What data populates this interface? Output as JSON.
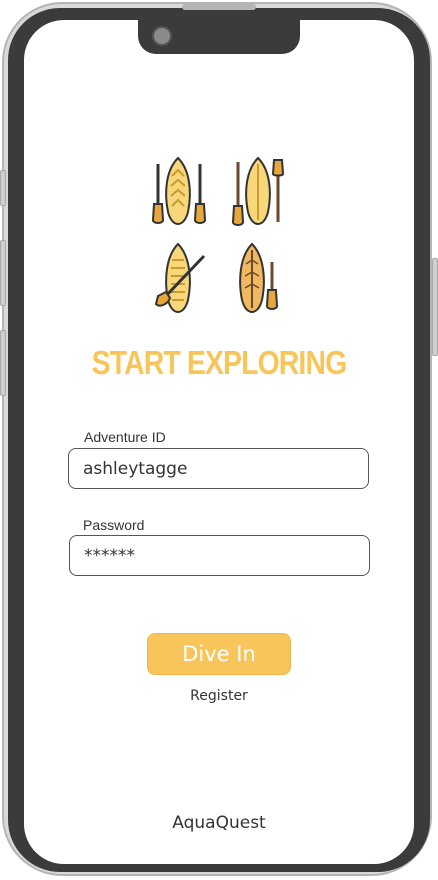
{
  "app": {
    "title": "START EXPLORING",
    "brand": "AquaQuest"
  },
  "form": {
    "id_label": "Adventure ID",
    "id_value": "ashleytagge",
    "password_label": "Password",
    "password_value": "******"
  },
  "actions": {
    "primary_label": "Dive In",
    "register_label": "Register"
  },
  "colors": {
    "accent": "#f7c55a",
    "bezel": "#3b3b3b",
    "text": "#333333"
  },
  "icons": {
    "hero": "paddle-boards-illustration"
  }
}
